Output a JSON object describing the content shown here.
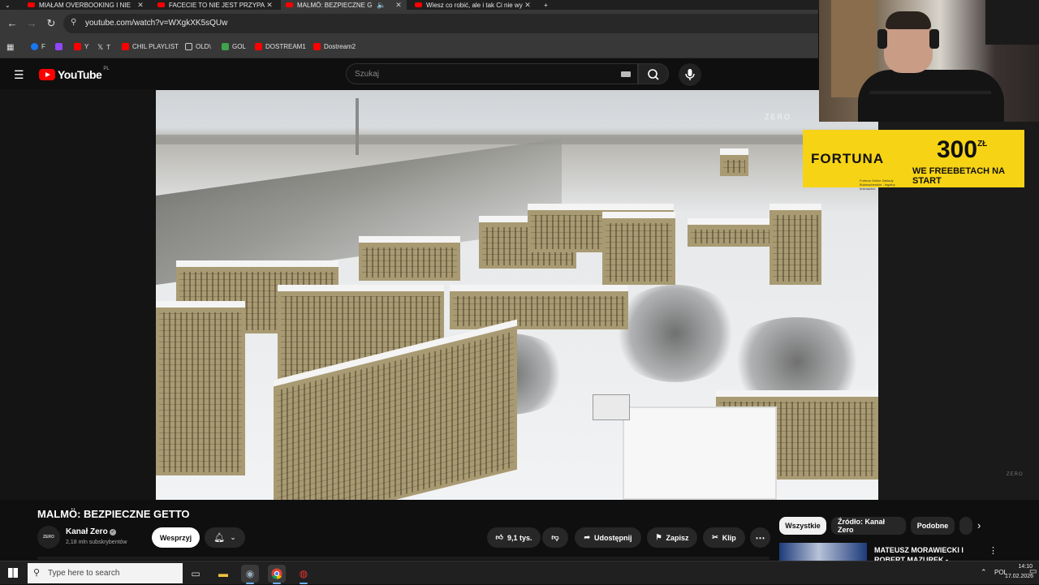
{
  "browser": {
    "tabs": [
      {
        "label": "MIAŁAM OVERBOOKING I NIE"
      },
      {
        "label": "FACECIE TO NIE JEST PRZYPADEK"
      },
      {
        "label": "MALMÖ: BEZPIECZNE GETTO"
      },
      {
        "label": "Wiesz co robić, ale i tak Ci nie wychodzi"
      }
    ],
    "new_tab_label": "+",
    "url": "youtube.com/watch?v=WXgkXK5sQUw",
    "bookmarks": [
      {
        "label": "F",
        "color": "#1877f2"
      },
      {
        "label": "",
        "color": "#9146ff"
      },
      {
        "label": "Y",
        "color": "#ff0000"
      },
      {
        "label": "T",
        "color": "#ffffff"
      },
      {
        "label": "CHIL PLAYLIST",
        "color": "#ff0000"
      },
      {
        "label": "OLD\\",
        "color": "#cccccc"
      },
      {
        "label": "GOL",
        "color": "#3fa34d"
      },
      {
        "label": "DOSTREAM1",
        "color": "#ff0000"
      },
      {
        "label": "Dostream2",
        "color": "#ff0000"
      }
    ]
  },
  "youtube": {
    "logo": "YouTube",
    "country": "PL",
    "search_placeholder": "Szukaj",
    "video_watermark": "ZERO",
    "title": "MALMÖ: BEZPIECZNE GETTO",
    "channel": {
      "avatar_text": "ZERO",
      "name": "Kanał Zero",
      "subscribers": "2,18 mln subskrybentów",
      "support_label": "Wesprzyj"
    },
    "actions": {
      "likes": "9,1 tys.",
      "share": "Udostępnij",
      "save": "Zapisz",
      "clip": "Klip",
      "more": "⋯"
    },
    "chips": [
      "Wszystkie",
      "Źródło: Kanał Zero",
      "Podobne"
    ],
    "recommended": {
      "title": "MATEUSZ MORAWIECKI I ROBERT MAZUREK - PORANN"
    }
  },
  "overlay": {
    "ad": {
      "brand": "FORTUNA",
      "amount": "300",
      "currency": "ZŁ",
      "promo": "WE FREEBETACH NA START",
      "legal": "Fortuna Online Zakłady Bukmacherskie - legalny bukmacher"
    }
  },
  "taskbar": {
    "search_placeholder": "Type here to search",
    "language": "POL",
    "time": "14:10",
    "date": "17.02.2026"
  }
}
